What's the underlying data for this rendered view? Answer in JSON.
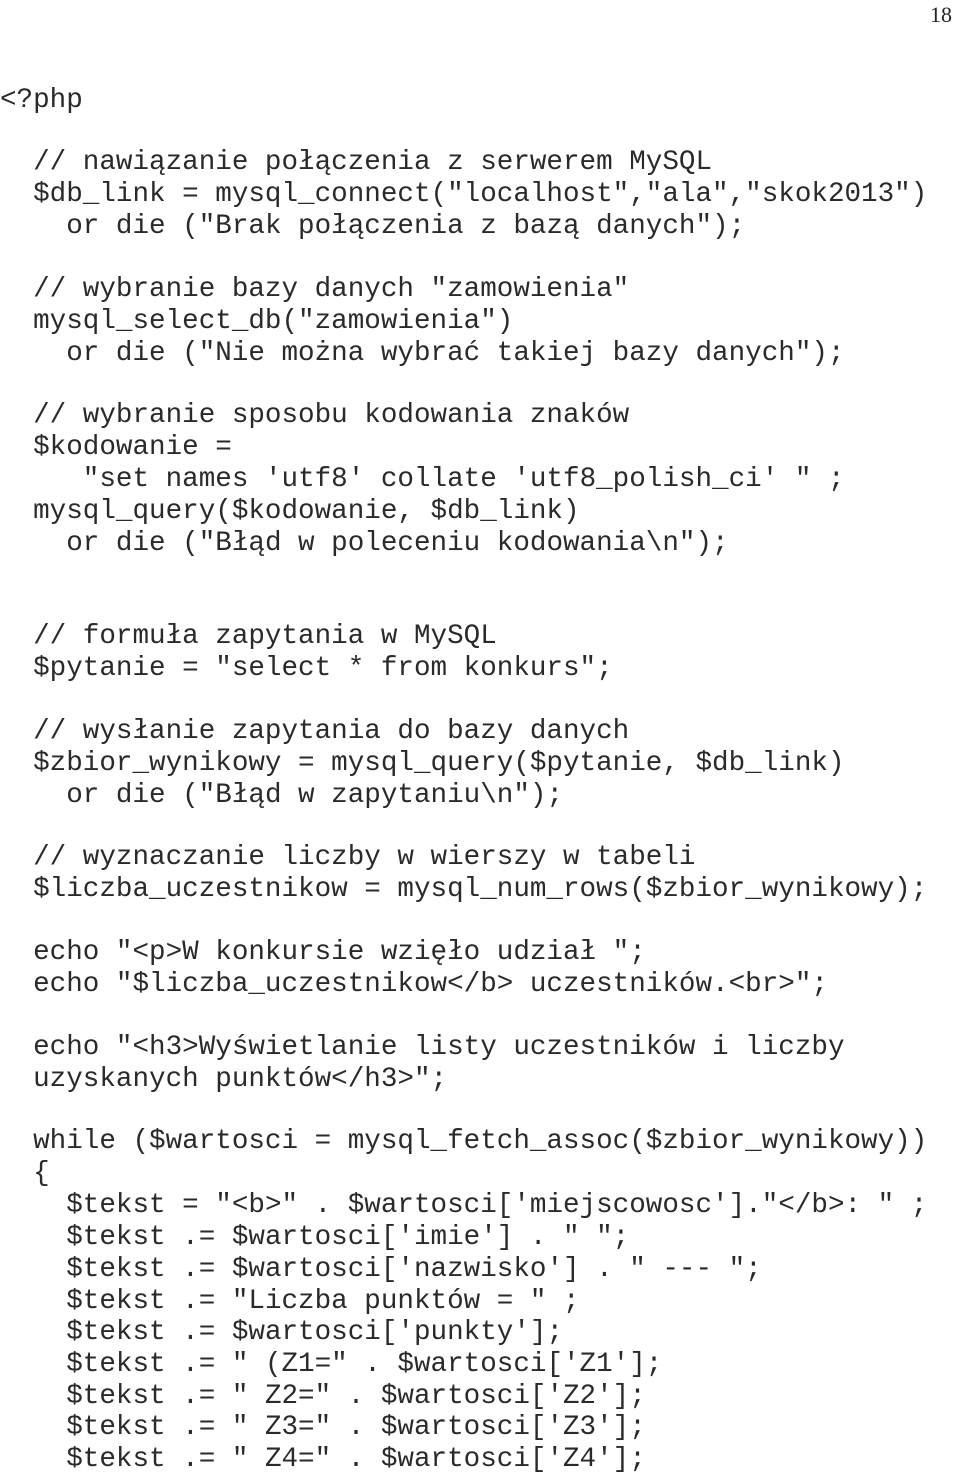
{
  "page_number": "18",
  "code_lines": [
    {
      "text": "<?php",
      "indent": 0
    },
    {
      "text": "// nawiązanie połączenia z serwerem MySQL",
      "indent": 2
    },
    {
      "text": "$db_link = mysql_connect(\"localhost\",\"ala\",\"skok2013\")",
      "indent": 2
    },
    {
      "text": "or die (\"Brak połączenia z bazą danych\");",
      "indent": 4
    },
    {
      "text": "// wybranie bazy danych \"zamowienia\"",
      "indent": 2
    },
    {
      "text": "mysql_select_db(\"zamowienia\")",
      "indent": 2
    },
    {
      "text": "or die (\"Nie można wybrać takiej bazy danych\");",
      "indent": 4
    },
    {
      "text": "// wybranie sposobu kodowania znaków",
      "indent": 2
    },
    {
      "text": "$kodowanie =",
      "indent": 2
    },
    {
      "text": "\"set names 'utf8' collate 'utf8_polish_ci' \" ;",
      "indent": 5
    },
    {
      "text": "mysql_query($kodowanie, $db_link)",
      "indent": 2
    },
    {
      "text": "or die (\"Błąd w poleceniu kodowania\\n\");",
      "indent": 4
    },
    {
      "text": "// formuła zapytania w MySQL",
      "indent": 2
    },
    {
      "text": "$pytanie = \"select * from konkurs\";",
      "indent": 2
    },
    {
      "text": "// wysłanie zapytania do bazy danych",
      "indent": 2
    },
    {
      "text": "$zbior_wynikowy = mysql_query($pytanie, $db_link)",
      "indent": 2
    },
    {
      "text": "or die (\"Błąd w zapytaniu\\n\");",
      "indent": 4
    },
    {
      "text": "// wyznaczanie liczby w wierszy w tabeli",
      "indent": 2
    },
    {
      "text": "$liczba_uczestnikow = mysql_num_rows($zbior_wynikowy);",
      "indent": 2
    },
    {
      "text": "echo \"<p>W konkursie wzięło udział \";",
      "indent": 2
    },
    {
      "text": "echo \"$liczba_uczestnikow</b> uczestników.<br>\";",
      "indent": 2
    },
    {
      "text": "echo \"<h3>Wyświetlanie listy uczestników i liczby",
      "indent": 2
    },
    {
      "text": "uzyskanych punktów</h3>\";",
      "indent": 2
    },
    {
      "text": "while ($wartosci = mysql_fetch_assoc($zbior_wynikowy))",
      "indent": 2
    },
    {
      "text": "{",
      "indent": 2
    },
    {
      "text": "$tekst = \"<b>\" . $wartosci['miejscowosc'].\"</b>: \" ;",
      "indent": 4
    },
    {
      "text": "$tekst .= $wartosci['imie'] . \" \";",
      "indent": 4
    },
    {
      "text": "$tekst .= $wartosci['nazwisko'] . \" --- \";",
      "indent": 4
    },
    {
      "text": "$tekst .= \"Liczba punktów = \" ;",
      "indent": 4
    },
    {
      "text": "$tekst .= $wartosci['punkty'];",
      "indent": 4
    },
    {
      "text": "$tekst .= \" (Z1=\" . $wartosci['Z1'];",
      "indent": 4
    },
    {
      "text": "$tekst .= \" Z2=\" . $wartosci['Z2'];",
      "indent": 4
    },
    {
      "text": "$tekst .= \" Z3=\" . $wartosci['Z3'];",
      "indent": 4
    },
    {
      "text": "$tekst .= \" Z4=\" . $wartosci['Z4'];",
      "indent": 4
    }
  ]
}
